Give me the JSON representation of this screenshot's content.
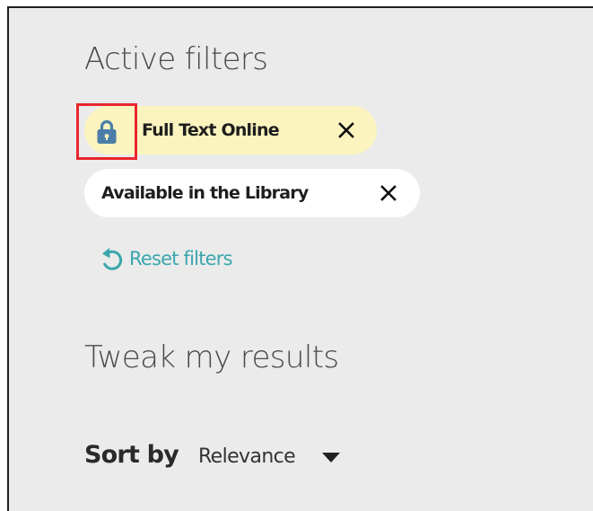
{
  "active_filters": {
    "title": "Active filters",
    "chips": [
      {
        "label": "Full Text Online",
        "icon": "lock-icon",
        "close_icon": "close-icon",
        "background": "#fbf4bf"
      },
      {
        "label": "Available in the Library",
        "close_icon": "close-icon",
        "background": "#ffffff"
      }
    ],
    "reset_label": "Reset filters",
    "reset_icon": "undo-arrow-icon"
  },
  "tweak": {
    "title": "Tweak my results",
    "sort_label": "Sort by",
    "sort_value": "Relevance",
    "caret_icon": "caret-down-icon"
  },
  "colors": {
    "panel_bg": "#ebebeb",
    "accent": "#3aa6ad",
    "lock_blue": "#4a7ea8",
    "highlight_border": "#e8262c",
    "chip_highlight": "#fbf4bf"
  }
}
